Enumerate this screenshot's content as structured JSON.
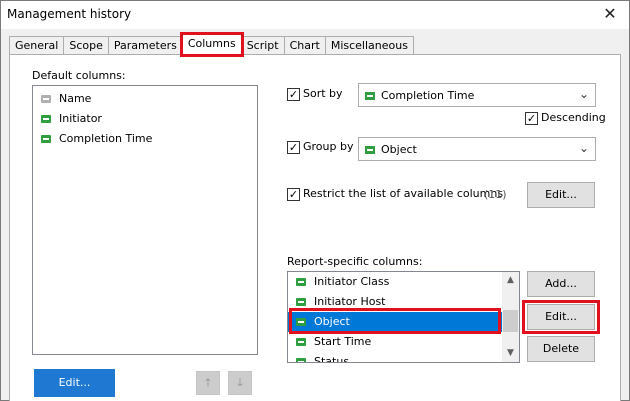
{
  "window": {
    "title": "Management history",
    "close_glyph": "✕"
  },
  "tabs": [
    {
      "label": "General"
    },
    {
      "label": "Scope"
    },
    {
      "label": "Parameters"
    },
    {
      "label": "Columns",
      "active": true
    },
    {
      "label": "Script"
    },
    {
      "label": "Chart"
    },
    {
      "label": "Miscellaneous"
    }
  ],
  "default_columns": {
    "label": "Default columns:",
    "items": [
      {
        "label": "Name",
        "icon": "column-gray-icon"
      },
      {
        "label": "Initiator",
        "icon": "column-green-icon"
      },
      {
        "label": "Completion Time",
        "icon": "column-green-icon"
      }
    ],
    "edit_button": "Edit...",
    "move_up_glyph": "🡑",
    "move_down_glyph": "🡓"
  },
  "sort_by": {
    "label": "Sort by",
    "checked": true,
    "value": "Completion Time",
    "descending_label": "Descending",
    "descending_checked": true
  },
  "group_by": {
    "label": "Group by",
    "checked": true,
    "value": "Object"
  },
  "restrict": {
    "label": "Restrict the list of available columns",
    "checked": true,
    "count": "(11)",
    "edit_button": "Edit..."
  },
  "report_columns": {
    "label": "Report-specific columns:",
    "items": [
      {
        "label": "Initiator Class"
      },
      {
        "label": "Initiator Host"
      },
      {
        "label": "Object",
        "selected": true
      },
      {
        "label": "Start Time"
      },
      {
        "label": "Status"
      }
    ],
    "add_button": "Add...",
    "edit_button": "Edit...",
    "delete_button": "Delete"
  },
  "colors": {
    "accent": "#0078d7",
    "highlight": "#e0101e",
    "column_icon": "#2e9e3e"
  }
}
